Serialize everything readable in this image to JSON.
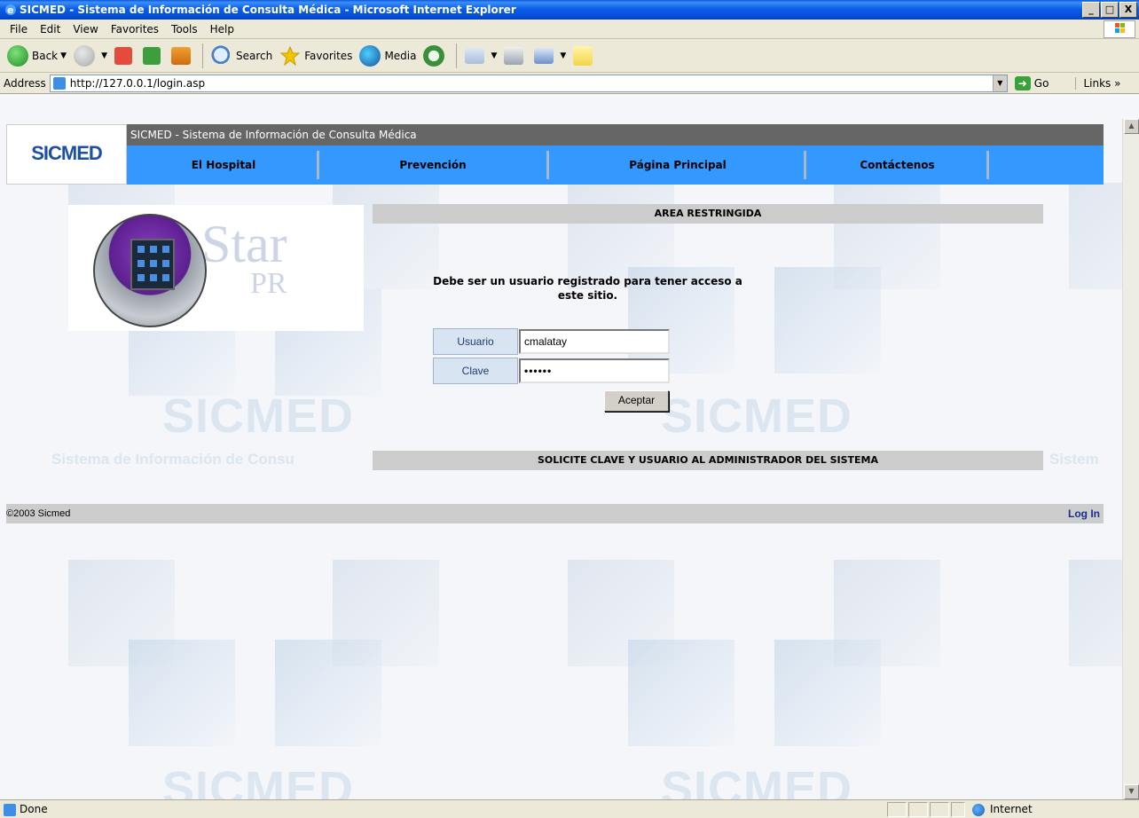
{
  "window": {
    "title": "SICMED - Sistema de Información de Consulta Médica - Microsoft Internet Explorer",
    "controls": [
      "_",
      "□",
      "X"
    ]
  },
  "menu": {
    "items": [
      "File",
      "Edit",
      "View",
      "Favorites",
      "Tools",
      "Help"
    ]
  },
  "toolbar": {
    "back_label": "Back",
    "search_label": "Search",
    "favorites_label": "Favorites",
    "media_label": "Media"
  },
  "address": {
    "label": "Address",
    "url": "http://127.0.0.1/login.asp",
    "go_label": "Go",
    "links_label": "Links"
  },
  "site": {
    "logo_text": "SICMED",
    "header_title": "SICMED - Sistema de Información de Consulta Médica",
    "nav": [
      "El Hospital",
      "Prevención",
      "Página Principal",
      "Contáctenos"
    ],
    "hero_text_1": "Star",
    "hero_text_2": "PR",
    "restricted_title": "AREA RESTRINGIDA",
    "message": "Debe ser un usuario registrado para tener acceso a este sitio.",
    "form": {
      "user_label": "Usuario",
      "user_value": "cmalatay",
      "pass_label": "Clave",
      "pass_value": "••••••",
      "submit_label": "Aceptar"
    },
    "request_note": "SOLICITE CLAVE Y USUARIO AL ADMINISTRADOR DEL SISTEMA",
    "footer": {
      "copyright": "©2003 Sicmed",
      "login_link": "Log In"
    },
    "watermark_big": "SICMED",
    "watermark_sub": "Sistema de Información de Consu",
    "watermark_sub_right": "Sistem"
  },
  "status": {
    "text": "Done",
    "zone": "Internet"
  }
}
